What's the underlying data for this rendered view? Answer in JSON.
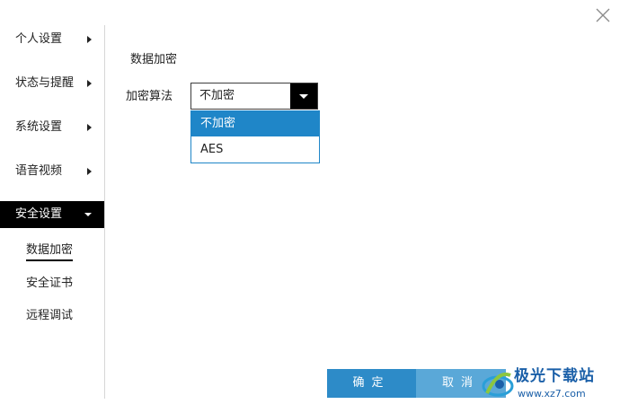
{
  "sidebar": {
    "items": [
      {
        "label": "个人设置"
      },
      {
        "label": "状态与提醒"
      },
      {
        "label": "系统设置"
      },
      {
        "label": "语音视频"
      },
      {
        "label": "安全设置"
      }
    ],
    "sub_items": [
      {
        "label": "数据加密"
      },
      {
        "label": "安全证书"
      },
      {
        "label": "远程调试"
      }
    ]
  },
  "main": {
    "section_title": "数据加密",
    "field_label": "加密算法",
    "select": {
      "value": "不加密",
      "options": [
        "不加密",
        "AES"
      ]
    }
  },
  "footer": {
    "ok_label": "确定",
    "cancel_label": "取消"
  },
  "watermark": {
    "text": "极光下载站",
    "url": "www.xz7.com"
  },
  "colors": {
    "accent": "#1f86c8",
    "ok_button": "#2d8bc8",
    "active_nav": "#000000"
  }
}
